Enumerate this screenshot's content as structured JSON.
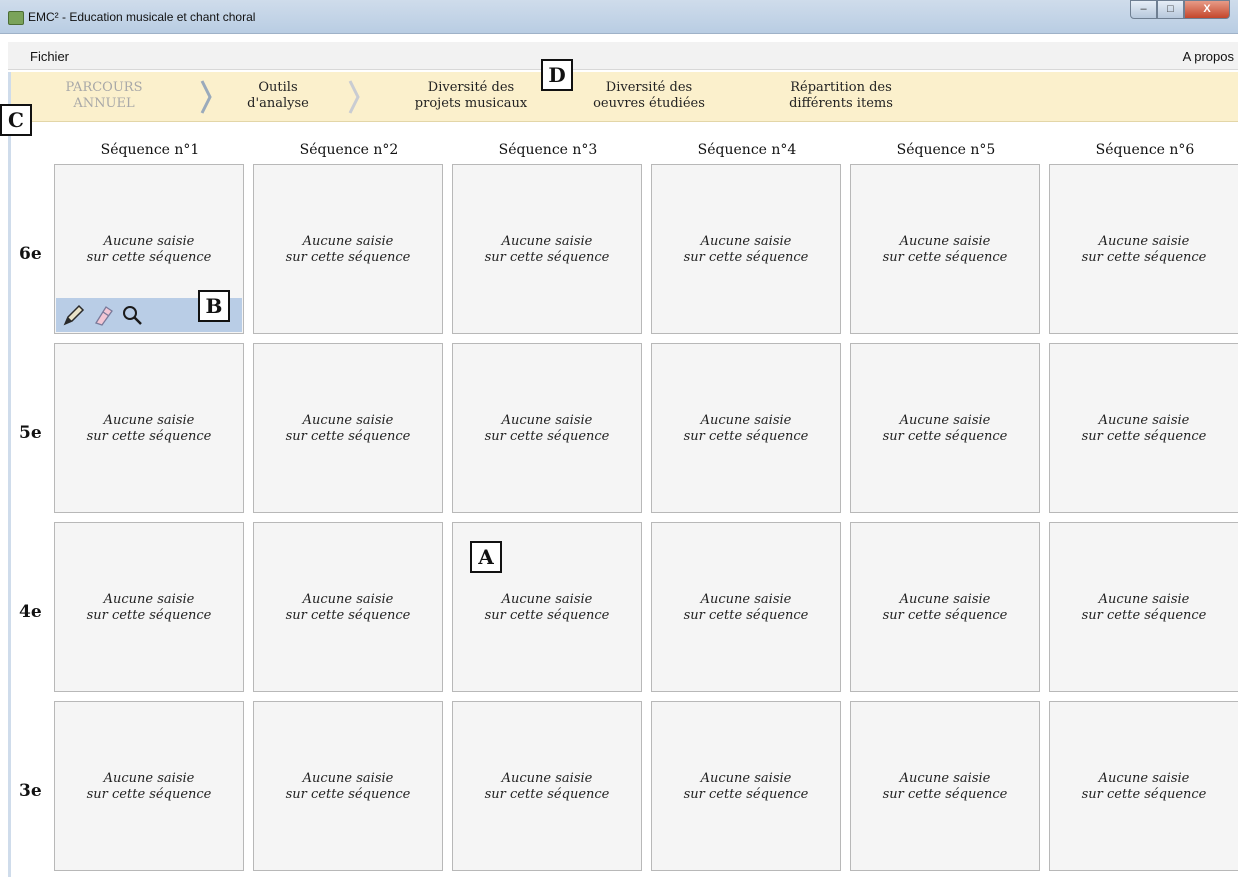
{
  "window": {
    "title": "EMC² - Education musicale et chant choral",
    "minimize_label": "–",
    "maximize_label": "□",
    "close_label": "X"
  },
  "menu": {
    "file": "Fichier",
    "about": "A propos"
  },
  "nav": {
    "parcours": [
      "PARCOURS",
      "ANNUEL"
    ],
    "outils": [
      "Outils",
      "d'analyse"
    ],
    "diversite_projets": [
      "Diversité des",
      "projets musicaux"
    ],
    "diversite_oeuvres": [
      "Diversité des",
      "oeuvres étudiées"
    ],
    "repartition": [
      "Répartition des",
      "différents items"
    ]
  },
  "markers": {
    "a": "A",
    "b": "B",
    "c": "C",
    "d": "D"
  },
  "sequences": [
    "Séquence n°1",
    "Séquence n°2",
    "Séquence n°3",
    "Séquence n°4",
    "Séquence n°5",
    "Séquence n°6"
  ],
  "levels": [
    "6e",
    "5e",
    "4e",
    "3e"
  ],
  "cell_text": [
    "Aucune saisie",
    "sur cette séquence"
  ],
  "toolbar_icons": [
    "pen-icon",
    "eraser-icon",
    "magnifier-icon"
  ],
  "colors": {
    "nav_background": "#fbf0cc",
    "toolbar_background": "#b9cde6",
    "cell_background": "#f5f5f5"
  }
}
